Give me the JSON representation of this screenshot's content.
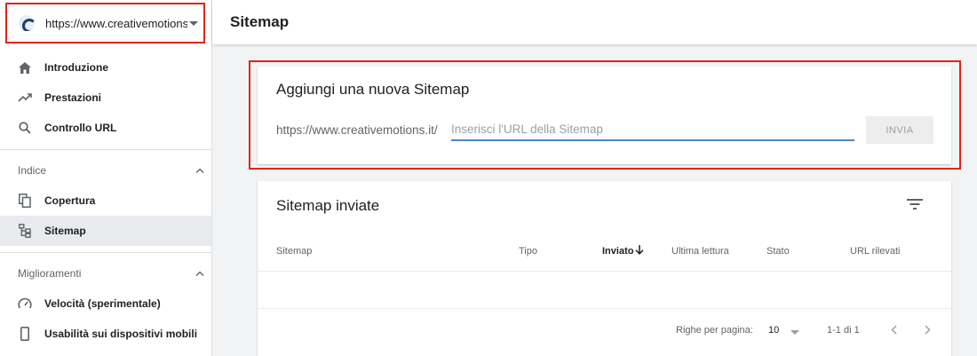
{
  "property": {
    "url": "https://www.creativemotions…"
  },
  "sidebar": {
    "items_top": [
      {
        "label": "Introduzione",
        "icon": "home-icon"
      },
      {
        "label": "Prestazioni",
        "icon": "trending-up-icon"
      },
      {
        "label": "Controllo URL",
        "icon": "search-icon"
      }
    ],
    "section_indice": "Indice",
    "items_indice": [
      {
        "label": "Copertura",
        "icon": "copy-pages-icon"
      },
      {
        "label": "Sitemap",
        "icon": "sitemap-tree-icon",
        "active": true
      }
    ],
    "section_miglioramenti": "Miglioramenti",
    "items_miglioramenti": [
      {
        "label": "Velocità (sperimentale)",
        "icon": "speedometer-icon"
      },
      {
        "label": "Usabilità sui dispositivi mobili",
        "icon": "smartphone-icon"
      }
    ]
  },
  "header": {
    "title": "Sitemap"
  },
  "add_sitemap": {
    "title": "Aggiungi una nuova Sitemap",
    "prefix": "https://www.creativemotions.it/",
    "placeholder": "Inserisci l'URL della Sitemap",
    "value": "",
    "submit_label": "INVIA"
  },
  "submitted": {
    "title": "Sitemap inviate",
    "columns": [
      "Sitemap",
      "Tipo",
      "Inviato",
      "Ultima lettura",
      "Stato",
      "URL rilevati"
    ],
    "rows": [],
    "footer": {
      "rows_per_page_label": "Righe per pagina:",
      "rows_per_page_value": "10",
      "range": "1-1 di 1"
    }
  },
  "colors": {
    "highlight": "#e2231a",
    "accent": "#4a86c7"
  }
}
